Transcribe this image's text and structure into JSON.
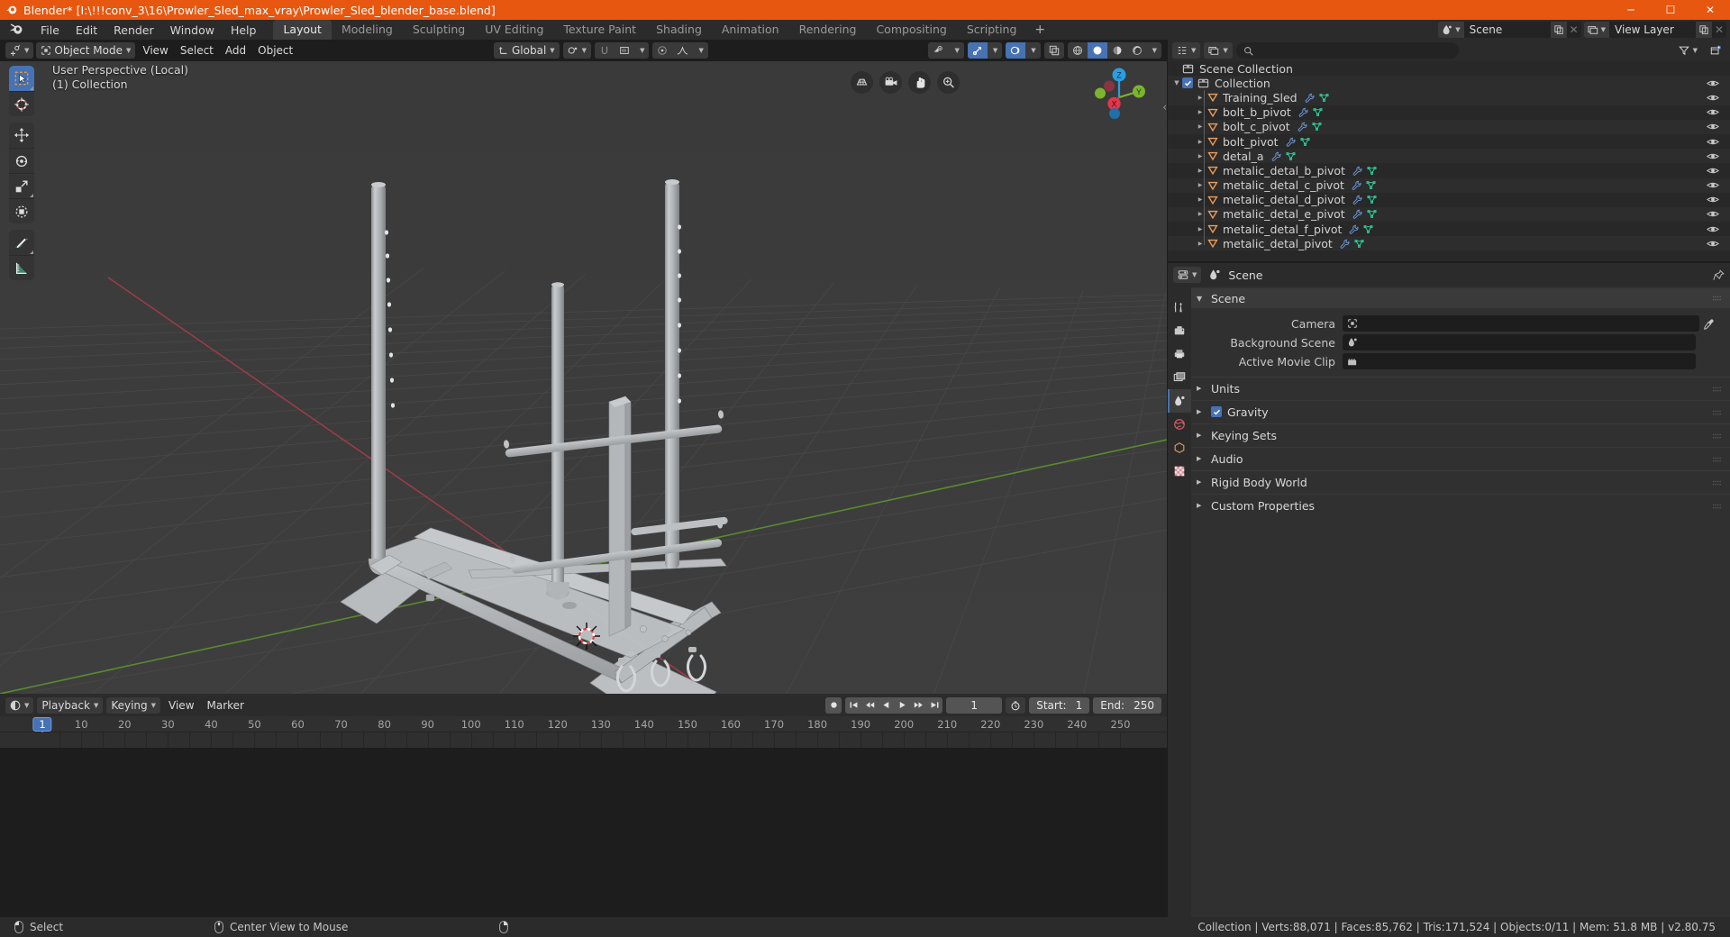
{
  "window": {
    "title": "Blender* [I:\\!!!conv_3\\16\\Prowler_Sled_max_vray\\Prowler_Sled_blender_base.blend]",
    "minimize": "─",
    "maximize": "☐",
    "close": "✕"
  },
  "menubar": {
    "items": [
      "File",
      "Edit",
      "Render",
      "Window",
      "Help"
    ],
    "workspaces": [
      {
        "label": "Layout",
        "active": true
      },
      {
        "label": "Modeling",
        "active": false
      },
      {
        "label": "Sculpting",
        "active": false
      },
      {
        "label": "UV Editing",
        "active": false
      },
      {
        "label": "Texture Paint",
        "active": false
      },
      {
        "label": "Shading",
        "active": false
      },
      {
        "label": "Animation",
        "active": false
      },
      {
        "label": "Rendering",
        "active": false
      },
      {
        "label": "Compositing",
        "active": false
      },
      {
        "label": "Scripting",
        "active": false
      }
    ],
    "add_workspace": "+",
    "scene_name": "Scene",
    "view_layer_name": "View Layer"
  },
  "viewport_header": {
    "mode": "Object Mode",
    "menus": [
      "View",
      "Select",
      "Add",
      "Object"
    ],
    "transform_orientation": "Global"
  },
  "viewport": {
    "overlay_line1": "User Perspective (Local)",
    "overlay_line2": "(1) Collection",
    "gizmo_axes": {
      "x": "X",
      "y": "Y",
      "z": "Z"
    },
    "tools": [
      "select-box-tool",
      "cursor-tool",
      "move-tool",
      "rotate-tool",
      "scale-tool",
      "transform-tool",
      "annotate-tool",
      "measure-tool"
    ],
    "nav_buttons": [
      "toggle-perspective-ortho",
      "camera-view",
      "pan-view",
      "zoom-view"
    ]
  },
  "timeline": {
    "editor_label": "Timeline",
    "menus": [
      "Playback",
      "Keying",
      "View",
      "Marker"
    ],
    "current_frame": "1",
    "start_label": "Start:",
    "start_value": "1",
    "end_label": "End:",
    "end_value": "250",
    "ticks": [
      10,
      20,
      30,
      40,
      50,
      60,
      70,
      80,
      90,
      100,
      110,
      120,
      130,
      140,
      150,
      160,
      170,
      180,
      190,
      200,
      210,
      220,
      230,
      240,
      250
    ]
  },
  "outliner": {
    "search_placeholder": "",
    "scene_collection": "Scene Collection",
    "collection": "Collection",
    "items": [
      {
        "name": "Training_Sled",
        "modifier": true,
        "mesh": true
      },
      {
        "name": "bolt_b_pivot",
        "modifier": true,
        "mesh": true
      },
      {
        "name": "bolt_c_pivot",
        "modifier": true,
        "mesh": true
      },
      {
        "name": "bolt_pivot",
        "modifier": true,
        "mesh": true
      },
      {
        "name": "detal_a",
        "modifier": true,
        "mesh": true
      },
      {
        "name": "metalic_detal_b_pivot",
        "modifier": true,
        "mesh": true
      },
      {
        "name": "metalic_detal_c_pivot",
        "modifier": true,
        "mesh": true
      },
      {
        "name": "metalic_detal_d_pivot",
        "modifier": true,
        "mesh": true
      },
      {
        "name": "metalic_detal_e_pivot",
        "modifier": true,
        "mesh": true
      },
      {
        "name": "metalic_detal_f_pivot",
        "modifier": true,
        "mesh": true
      },
      {
        "name": "metalic_detal_pivot",
        "modifier": true,
        "mesh": true
      }
    ]
  },
  "properties": {
    "breadcrumb": "Scene",
    "panel_title": "Scene",
    "rows": [
      {
        "label": "Camera",
        "value": "",
        "icon": "camera-data-icon"
      },
      {
        "label": "Background Scene",
        "value": "",
        "icon": "scene-icon"
      },
      {
        "label": "Active Movie Clip",
        "value": "",
        "icon": "clip-icon"
      }
    ],
    "sections": [
      {
        "label": "Units",
        "checkbox": false
      },
      {
        "label": "Gravity",
        "checkbox": true
      },
      {
        "label": "Keying Sets",
        "checkbox": false
      },
      {
        "label": "Audio",
        "checkbox": false
      },
      {
        "label": "Rigid Body World",
        "checkbox": false
      },
      {
        "label": "Custom Properties",
        "checkbox": false
      }
    ],
    "tabs": [
      "tool-icon",
      "render-icon",
      "output-icon",
      "view-layer-icon",
      "scene-icon",
      "world-icon",
      "object-icon",
      "texture-icon"
    ]
  },
  "statusbar": {
    "mouse_left_label": "Select",
    "mouse_middle_label": "Center View to Mouse",
    "stats": "Collection | Verts:88,071 | Faces:85,762 | Tris:171,524 | Objects:0/11 | Mem: 51.8 MB | v2.80.75"
  },
  "colors": {
    "accent": "#4772b3",
    "title_bar": "#e8570f",
    "viewport_bg": "#3b3b3b",
    "axis_x": "#9a3c4a",
    "axis_y": "#5a8a2f",
    "object_icon": "#ed9e5c",
    "mesh_icon": "#2fd19b",
    "modifier_icon": "#6a95d4"
  }
}
